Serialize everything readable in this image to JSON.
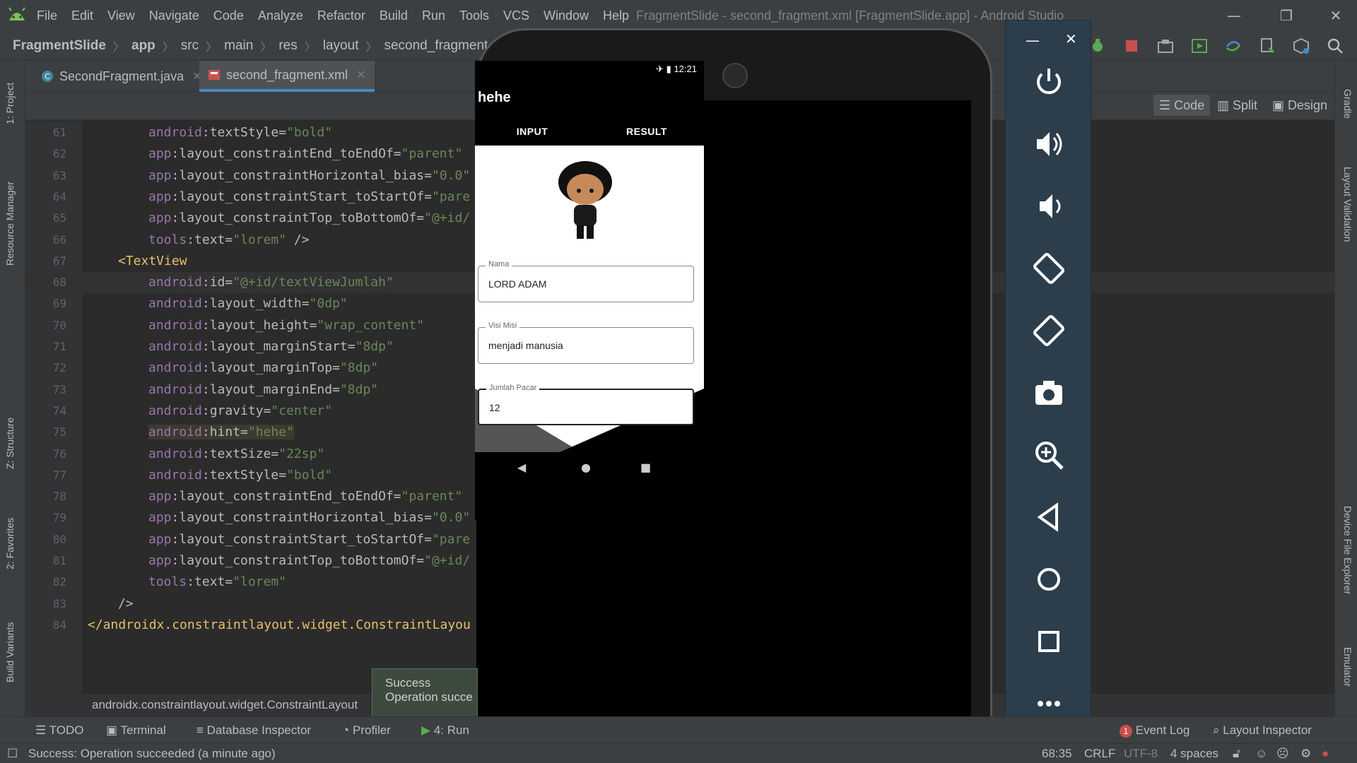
{
  "menubar": {
    "items": [
      "File",
      "Edit",
      "View",
      "Navigate",
      "Code",
      "Analyze",
      "Refactor",
      "Build",
      "Run",
      "Tools",
      "VCS",
      "Window",
      "Help"
    ],
    "title": "FragmentSlide - second_fragment.xml [FragmentSlide.app] - Android Studio"
  },
  "breadcrumb": [
    "FragmentSlide",
    "app",
    "src",
    "main",
    "res",
    "layout",
    "second_fragment.xml"
  ],
  "tabs": [
    {
      "label": "SecondFragment.java",
      "icon": "java-class-icon"
    },
    {
      "label": "second_fragment.xml",
      "icon": "xml-layout-icon"
    }
  ],
  "view_modes": [
    "Code",
    "Split",
    "Design"
  ],
  "code_lines": [
    {
      "n": "61",
      "parts": [
        [
          "ns",
          "android"
        ],
        [
          "at",
          ":textStyle="
        ],
        [
          "val",
          "\"bold\""
        ]
      ]
    },
    {
      "n": "62",
      "parts": [
        [
          "ns",
          "app"
        ],
        [
          "at",
          ":layout_constraintEnd_toEndOf="
        ],
        [
          "val",
          "\"parent\""
        ]
      ]
    },
    {
      "n": "63",
      "parts": [
        [
          "ns",
          "app"
        ],
        [
          "at",
          ":layout_constraintHorizontal_bias="
        ],
        [
          "val",
          "\"0.0\""
        ]
      ]
    },
    {
      "n": "64",
      "parts": [
        [
          "ns",
          "app"
        ],
        [
          "at",
          ":layout_constraintStart_toStartOf="
        ],
        [
          "val",
          "\"pare"
        ]
      ]
    },
    {
      "n": "65",
      "parts": [
        [
          "ns",
          "app"
        ],
        [
          "at",
          ":layout_constraintTop_toBottomOf="
        ],
        [
          "val",
          "\"@+id/"
        ]
      ]
    },
    {
      "n": "66",
      "parts": [
        [
          "ns",
          "tools"
        ],
        [
          "at",
          ":text="
        ],
        [
          "val",
          "\"lorem\""
        ],
        [
          "punc",
          " />"
        ]
      ]
    },
    {
      "n": "67",
      "parts": [
        [
          "tag",
          "<TextView"
        ]
      ]
    },
    {
      "n": "68",
      "parts": [
        [
          "ns",
          "android"
        ],
        [
          "at",
          ":id="
        ],
        [
          "val",
          "\"@+id/textViewJumlah\""
        ]
      ]
    },
    {
      "n": "69",
      "parts": [
        [
          "ns",
          "android"
        ],
        [
          "at",
          ":layout_width="
        ],
        [
          "val",
          "\"0dp\""
        ]
      ]
    },
    {
      "n": "70",
      "parts": [
        [
          "ns",
          "android"
        ],
        [
          "at",
          ":layout_height="
        ],
        [
          "val",
          "\"wrap_content\""
        ]
      ]
    },
    {
      "n": "71",
      "parts": [
        [
          "ns",
          "android"
        ],
        [
          "at",
          ":layout_marginStart="
        ],
        [
          "val",
          "\"8dp\""
        ]
      ]
    },
    {
      "n": "72",
      "parts": [
        [
          "ns",
          "android"
        ],
        [
          "at",
          ":layout_marginTop="
        ],
        [
          "val",
          "\"8dp\""
        ]
      ]
    },
    {
      "n": "73",
      "parts": [
        [
          "ns",
          "android"
        ],
        [
          "at",
          ":layout_marginEnd="
        ],
        [
          "val",
          "\"8dp\""
        ]
      ]
    },
    {
      "n": "74",
      "parts": [
        [
          "ns",
          "android"
        ],
        [
          "at",
          ":gravity="
        ],
        [
          "val",
          "\"center\""
        ]
      ]
    },
    {
      "n": "75",
      "parts": [
        [
          "ns",
          "android"
        ],
        [
          "at",
          ":hint="
        ],
        [
          "val",
          "\"hehe\""
        ]
      ]
    },
    {
      "n": "76",
      "parts": [
        [
          "ns",
          "android"
        ],
        [
          "at",
          ":textSize="
        ],
        [
          "val",
          "\"22sp\""
        ]
      ]
    },
    {
      "n": "77",
      "parts": [
        [
          "ns",
          "android"
        ],
        [
          "at",
          ":textStyle="
        ],
        [
          "val",
          "\"bold\""
        ]
      ]
    },
    {
      "n": "78",
      "parts": [
        [
          "ns",
          "app"
        ],
        [
          "at",
          ":layout_constraintEnd_toEndOf="
        ],
        [
          "val",
          "\"parent\""
        ]
      ]
    },
    {
      "n": "79",
      "parts": [
        [
          "ns",
          "app"
        ],
        [
          "at",
          ":layout_constraintHorizontal_bias="
        ],
        [
          "val",
          "\"0.0\""
        ]
      ]
    },
    {
      "n": "80",
      "parts": [
        [
          "ns",
          "app"
        ],
        [
          "at",
          ":layout_constraintStart_toStartOf="
        ],
        [
          "val",
          "\"pare"
        ]
      ]
    },
    {
      "n": "81",
      "parts": [
        [
          "ns",
          "app"
        ],
        [
          "at",
          ":layout_constraintTop_toBottomOf="
        ],
        [
          "val",
          "\"@+id/"
        ]
      ]
    },
    {
      "n": "82",
      "parts": [
        [
          "ns",
          "tools"
        ],
        [
          "at",
          ":text="
        ],
        [
          "val",
          "\"lorem\""
        ]
      ]
    },
    {
      "n": "83",
      "parts": [
        [
          "punc",
          "/>"
        ]
      ]
    },
    {
      "n": "84",
      "parts": [
        [
          "tag",
          "</androidx.constraintlayout.widget.ConstraintLayou"
        ]
      ]
    }
  ],
  "editor_breadcrumb": "androidx.constraintlayout.widget.ConstraintLayout",
  "toast": {
    "title": "Success",
    "body": "Operation succe"
  },
  "bottom_tools": [
    "TODO",
    "Terminal",
    "Database Inspector",
    "Profiler",
    "4: Run",
    "Event Log",
    "Layout Inspector"
  ],
  "event_log_count": "1",
  "status": {
    "message": "Success: Operation succeeded (a minute ago)",
    "position": "68:35",
    "line_sep": "CRLF",
    "encoding": "UTF-8",
    "indent": "4 spaces"
  },
  "left_tools": [
    "1: Project",
    "Resource Manager",
    "Z: Structure",
    "2: Favorites",
    "Build Variants"
  ],
  "right_tools": [
    "Gradle",
    "Layout Validation",
    "Device File Explorer",
    "Emulator"
  ],
  "phone": {
    "time": "12:21",
    "app_title": "hehe",
    "tabs": [
      "INPUT",
      "RESULT"
    ],
    "fields": [
      {
        "label": "Nama",
        "value": "LORD ADAM"
      },
      {
        "label": "Visi Misi",
        "value": "menjadi manusia"
      },
      {
        "label": "Jumlah Pacar",
        "value": "12"
      }
    ]
  },
  "emulator_controls": [
    "power-icon",
    "volume-up-icon",
    "volume-down-icon",
    "rotate-left-icon",
    "rotate-right-icon",
    "camera-icon",
    "zoom-icon",
    "back-icon",
    "home-icon",
    "overview-icon",
    "more-icon"
  ],
  "colors": {
    "accent": "#4a88c7",
    "ide_bg": "#2b2b2b",
    "panel": "#3c3f41",
    "emu_panel": "#2c3e4c"
  }
}
